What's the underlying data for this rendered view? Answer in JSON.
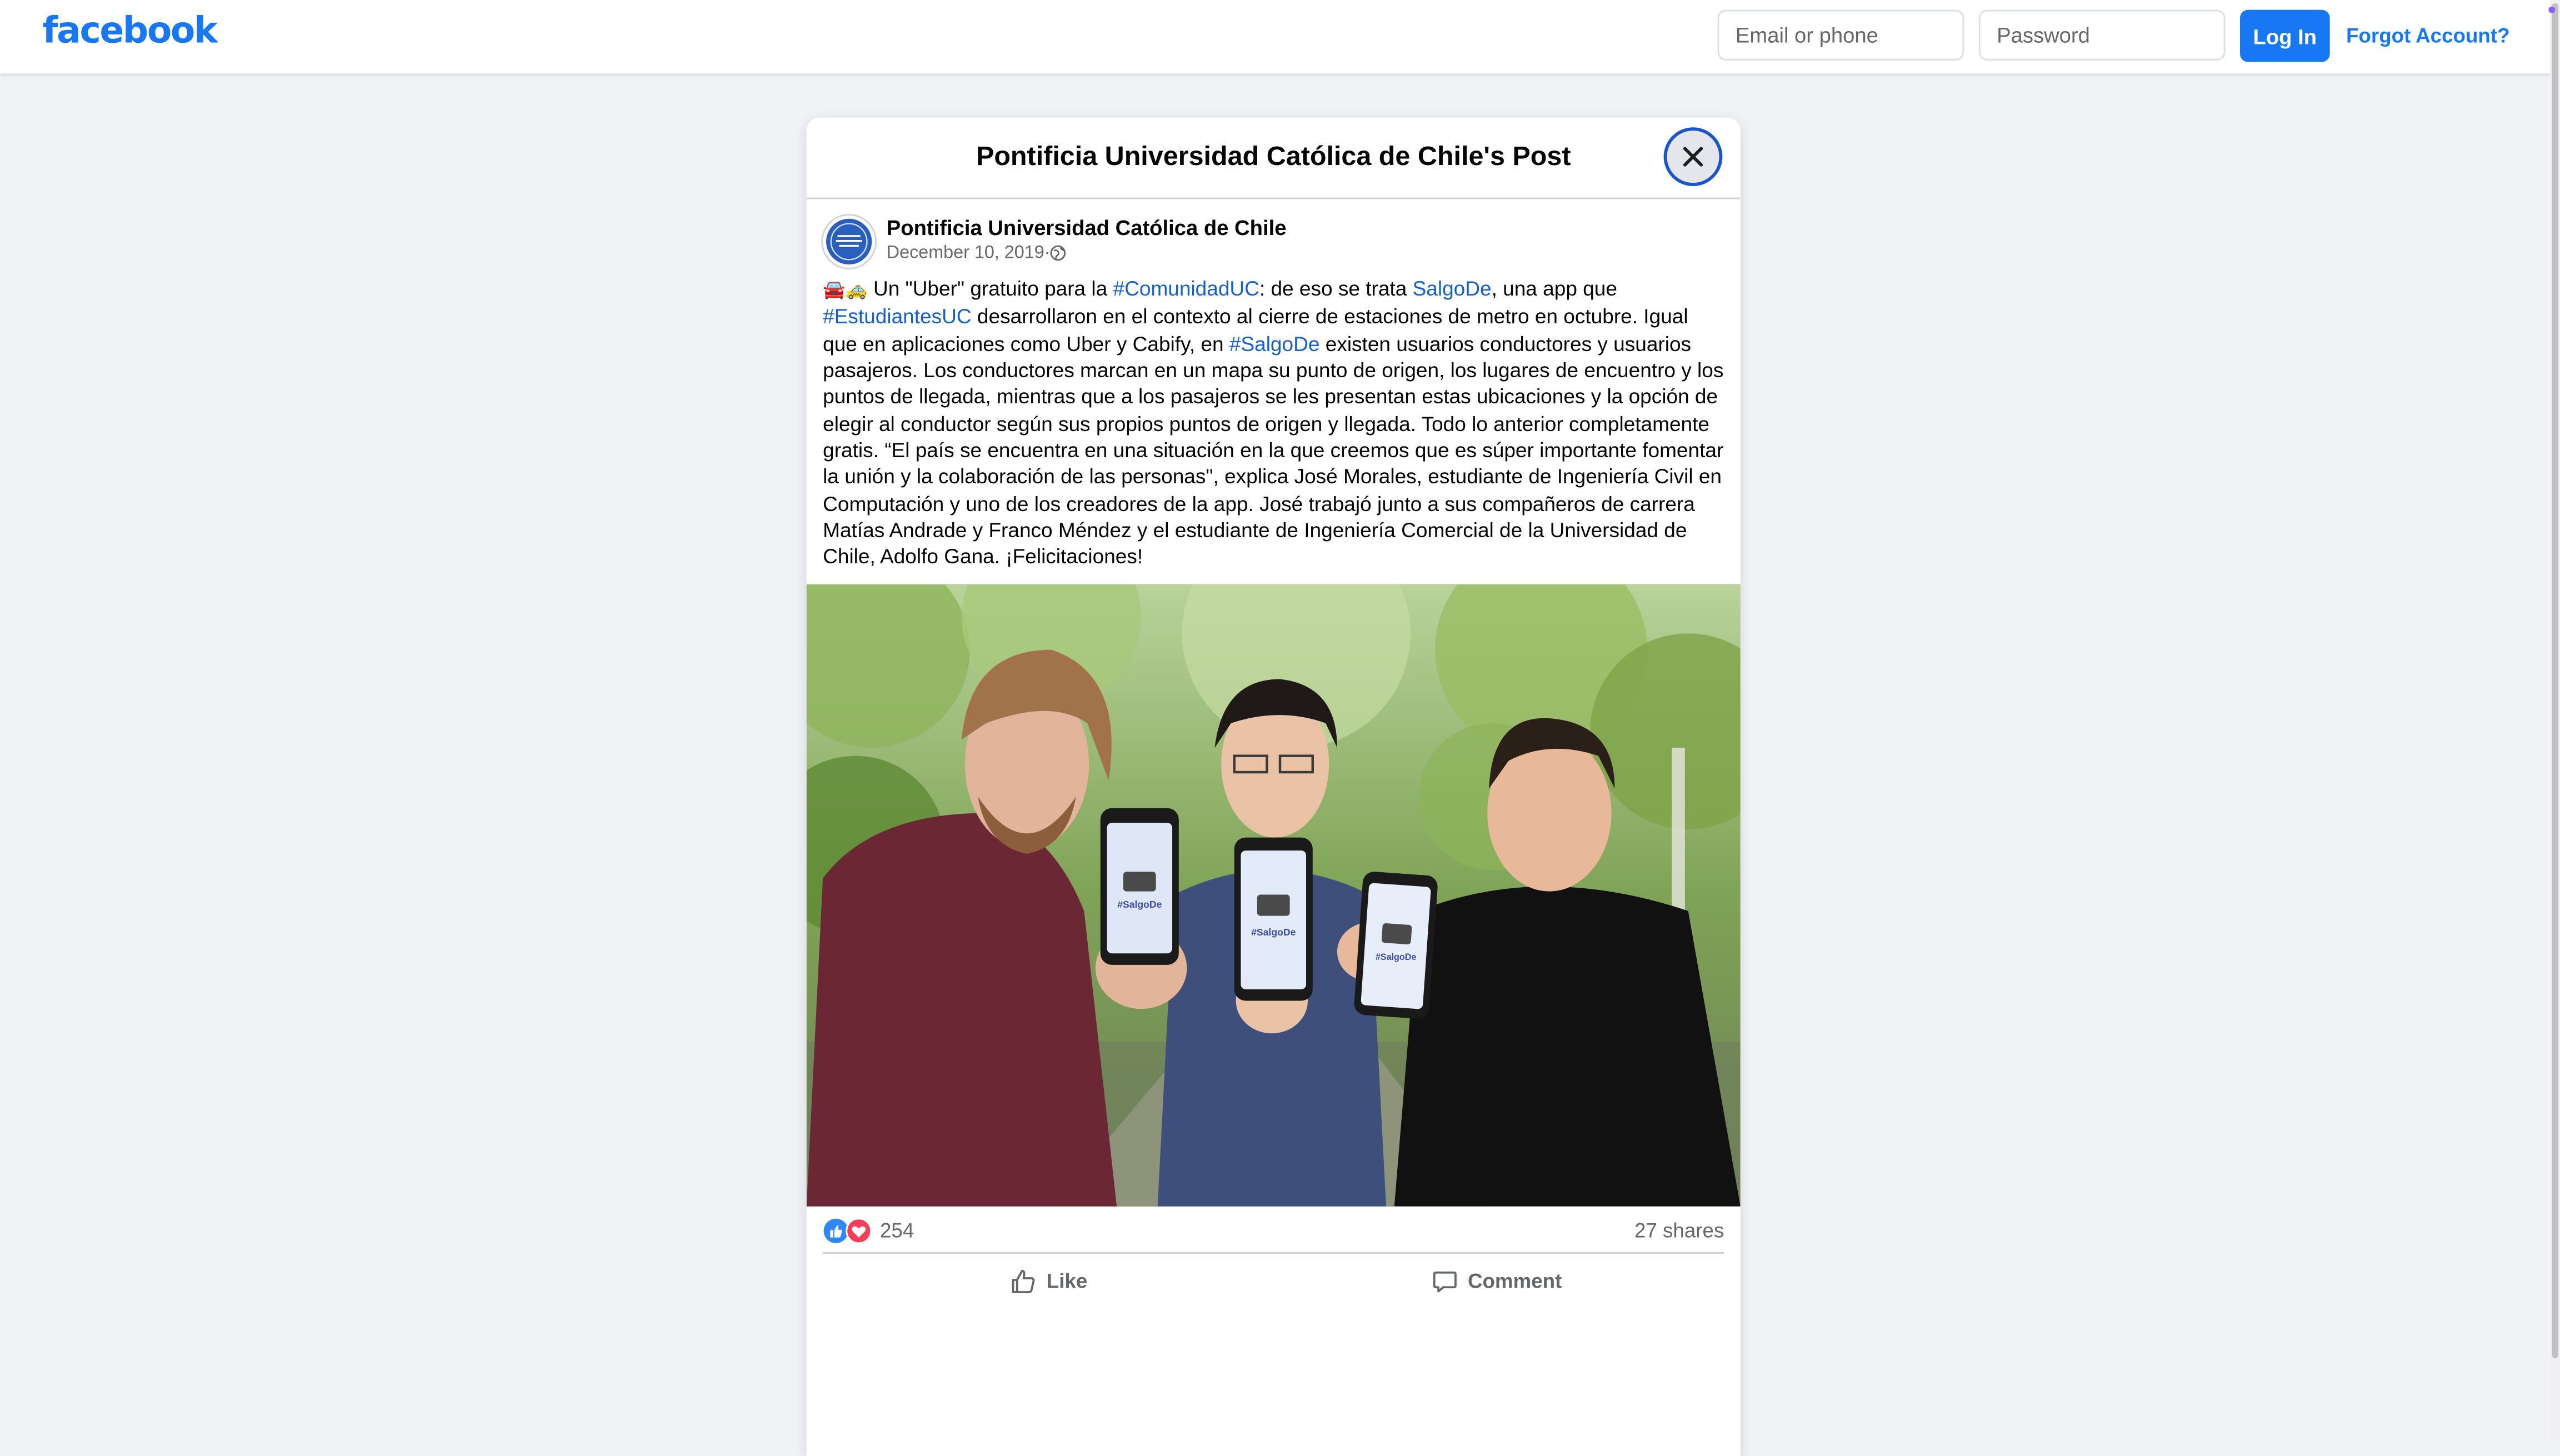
{
  "topbar": {
    "logo": "facebook",
    "email_placeholder": "Email or phone",
    "password_placeholder": "Password",
    "login_label": "Log In",
    "forgot_label": "Forgot Account?",
    "brand_color": "#1877f2"
  },
  "dialog": {
    "title": "Pontificia Universidad Católica de Chile's Post",
    "close_icon": "close-icon"
  },
  "post": {
    "author": "Pontificia Universidad Católica de Chile",
    "date": "December 10, 2019",
    "separator": " · ",
    "audience_icon": "globe-icon",
    "emoji": "🚘🚕",
    "text_segments": [
      " Un \"Uber\" gratuito para la ",
      "#ComunidadUC",
      ": de eso se trata ",
      "SalgoDe",
      ", una app que ",
      "#EstudiantesUC",
      " desarrollaron en el contexto al cierre de estaciones de metro en octubre. Igual que en aplicaciones como Uber y Cabify, en ",
      "#SalgoDe",
      " existen usuarios conductores y usuarios pasajeros. Los conductores marcan en un mapa su punto de origen, los lugares de encuentro y los puntos de llegada, mientras que a los pasajeros se les presentan estas ubicaciones y la opción de elegir al conductor según sus propios puntos de origen y llegada. Todo lo anterior completamente gratis. “El país se encuentra en una situación en la que creemos que es súper importante fomentar la unión y la colaboración de las personas\", explica José Morales, estudiante de Ingeniería Civil en Computación y uno de los creadores de la app. José trabajó junto a sus compañeros de carrera Matías Andrade y Franco Méndez y el estudiante de Ingeniería Comercial de la Universidad de Chile, Adolfo Gana. ¡Felicitaciones!"
    ],
    "photo_phone_label": "#SalgoDe",
    "reactions": {
      "icons": [
        "like-reaction-icon",
        "love-reaction-icon"
      ],
      "count": "254",
      "shares": "27 shares"
    },
    "actions": {
      "like_label": "Like",
      "comment_label": "Comment"
    }
  },
  "colors": {
    "background": "#f0f2f5",
    "link": "#1660c8",
    "secondary_text": "#65676b"
  }
}
